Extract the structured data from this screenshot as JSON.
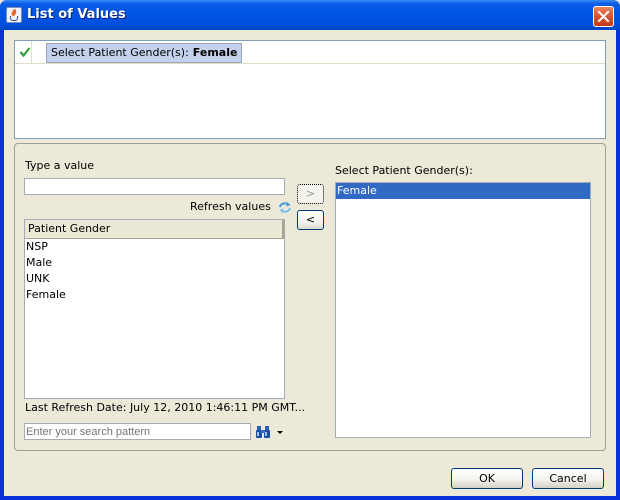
{
  "window": {
    "title": "List of Values",
    "app_icon": "java-cup-icon",
    "close_icon": "close-icon"
  },
  "summary": {
    "status_icon": "check-icon",
    "label": "Select Patient Gender(s):",
    "value": "Female"
  },
  "left": {
    "type_label": "Type a value",
    "type_value": "",
    "refresh_label": "Refresh values",
    "refresh_icon": "refresh-icon",
    "column_header": "Patient Gender",
    "items": [
      "NSP",
      "Male",
      "UNK",
      "Female"
    ],
    "last_refresh": "Last Refresh Date: July 12, 2010 1:46:11 PM GMT...",
    "search_placeholder": "Enter your search pattern",
    "search_icon": "binoculars-icon",
    "search_dropdown_icon": "dropdown-arrow-icon"
  },
  "transfer": {
    "add_label": ">",
    "remove_label": "<"
  },
  "right": {
    "label": "Select Patient Gender(s):",
    "items": [
      "Female"
    ],
    "selected_index": 0
  },
  "buttons": {
    "ok": "OK",
    "cancel": "Cancel"
  },
  "colors": {
    "titlebar": "#0055e5",
    "selection": "#316ac5",
    "chip": "#c3d1ec",
    "check": "#2f9e3a",
    "close": "#d8532c"
  }
}
